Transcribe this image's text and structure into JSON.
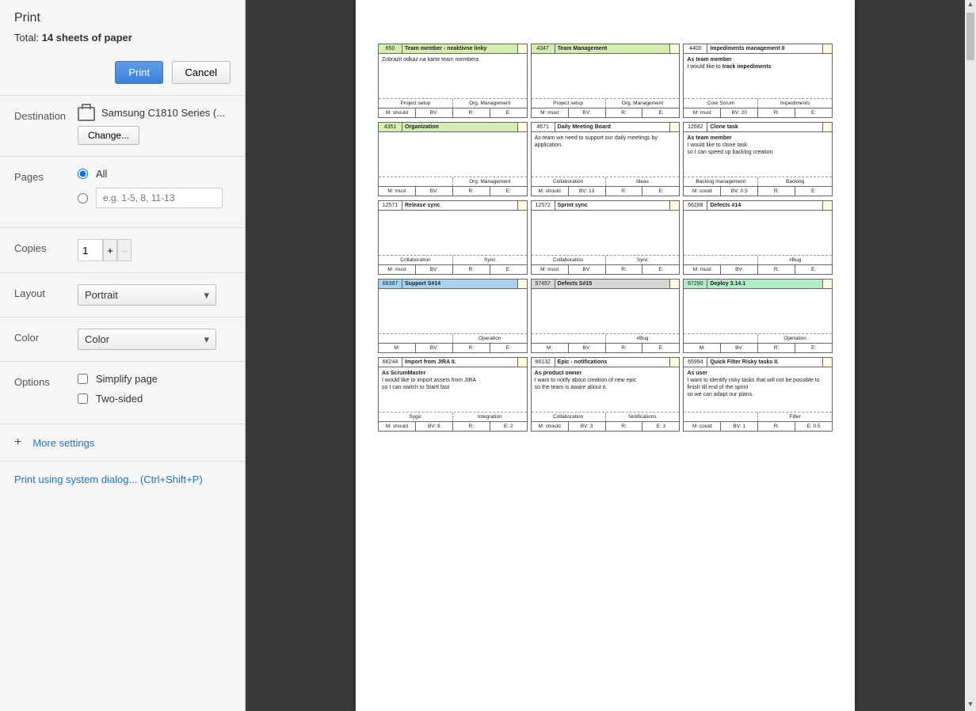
{
  "sidebar": {
    "title": "Print",
    "total_prefix": "Total: ",
    "total_value": "14 sheets of paper",
    "print_btn": "Print",
    "cancel_btn": "Cancel",
    "destination_label": "Destination",
    "destination_value": "Samsung C1810 Series (...",
    "change_btn": "Change...",
    "pages_label": "Pages",
    "pages_all": "All",
    "pages_placeholder": "e.g. 1-5, 8, 11-13",
    "copies_label": "Copies",
    "copies_value": "1",
    "layout_label": "Layout",
    "layout_value": "Portrait",
    "color_label": "Color",
    "color_value": "Color",
    "options_label": "Options",
    "opt_simplify": "Simplify page",
    "opt_twosided": "Two-sided",
    "more_settings": "More settings",
    "system_dialog": "Print using system dialog... (Ctrl+Shift+P)"
  },
  "cards": [
    [
      {
        "id": "650",
        "title": "Team member - neaktivne linky",
        "head_bg": "bg-green",
        "body": "Zobrazit odkaz na karte team membera",
        "tags": [
          "Project setup",
          "Org. Management"
        ],
        "meta": [
          "M: should",
          "BV:",
          "R:",
          "E:"
        ]
      },
      {
        "id": "4347",
        "title": "Team Management",
        "head_bg": "bg-green",
        "body": "",
        "tags": [
          "Project setup",
          "Org. Management"
        ],
        "meta": [
          "M: must",
          "BV:",
          "R:",
          "E:"
        ]
      },
      {
        "id": "4400",
        "title": "Impediments management II",
        "head_bg": "",
        "body": "<b>As team member</b><br>I would like to <b>track impediments</b>",
        "tags": [
          "Core Scrum",
          "Impediments"
        ],
        "meta": [
          "M: must",
          "BV: 20",
          "R:",
          "E:"
        ]
      }
    ],
    [
      {
        "id": "4351",
        "title": "Organization",
        "head_bg": "bg-green",
        "body": "",
        "tags": [
          "",
          "Org. Management"
        ],
        "meta": [
          "M: must",
          "BV:",
          "R:",
          "E:"
        ]
      },
      {
        "id": "4671",
        "title": "Daily Meeting Board",
        "head_bg": "",
        "body": "As team we need to support our daily meetings by application.",
        "tags": [
          "Collaboration",
          "Ideas"
        ],
        "meta": [
          "M: should",
          "BV: 13",
          "R:",
          "E:"
        ]
      },
      {
        "id": "12682",
        "title": "Clone task",
        "head_bg": "",
        "body": "<b>As team member</b><br>I would like to clone task<br>so I can speed up backlog creation",
        "tags": [
          "Backlog management",
          "Backlog"
        ],
        "meta": [
          "M: could",
          "BV: 0.5",
          "R:",
          "E:"
        ]
      }
    ],
    [
      {
        "id": "12571",
        "title": "Release sync",
        "head_bg": "",
        "body": "",
        "tags": [
          "Collaboration",
          "Sync"
        ],
        "meta": [
          "M: must",
          "BV:",
          "R:",
          "E:"
        ]
      },
      {
        "id": "12572",
        "title": "Sprint sync",
        "head_bg": "",
        "body": "",
        "tags": [
          "Collaboration",
          "Sync"
        ],
        "meta": [
          "M: must",
          "BV:",
          "R:",
          "E:"
        ]
      },
      {
        "id": "66288",
        "title": "Defects #14",
        "head_bg": "",
        "body": "",
        "tags": [
          "",
          "#Bug"
        ],
        "meta": [
          "M: must",
          "BV:",
          "R:",
          "E:"
        ]
      }
    ],
    [
      {
        "id": "68387",
        "title": "Support S#14",
        "head_bg": "bg-blue",
        "body": "",
        "tags": [
          "",
          "Operation"
        ],
        "meta": [
          "M:",
          "BV:",
          "R:",
          "E:"
        ]
      },
      {
        "id": "57457",
        "title": "Defects S#15",
        "head_bg": "bg-grey",
        "body": "",
        "tags": [
          "",
          "#Bug"
        ],
        "meta": [
          "M:",
          "BV:",
          "R:",
          "E:"
        ]
      },
      {
        "id": "67290",
        "title": "Deploy 3.14.1",
        "head_bg": "bg-mint",
        "body": "",
        "tags": [
          "",
          "Operation"
        ],
        "meta": [
          "M:",
          "BV:",
          "R:",
          "E:"
        ]
      }
    ],
    [
      {
        "id": "66244",
        "title": "Import from JIRA II.",
        "head_bg": "",
        "body": "<b>As ScrumMaster</b><br>I would like to import assets from JIRA<br>so I can switch to Startl fast",
        "tags": [
          "Sygic",
          "Integration"
        ],
        "meta": [
          "M: should",
          "BV: 8",
          "R:",
          "E: 2"
        ]
      },
      {
        "id": "66132",
        "title": "Epic - notifications",
        "head_bg": "",
        "body": "<b>As product owner</b><br>I want to notify about creation of new epic<br>so the team is aware about it.",
        "tags": [
          "Collaboration",
          "Notifications"
        ],
        "meta": [
          "M: should",
          "BV: 3",
          "R:",
          "E: 3"
        ]
      },
      {
        "id": "65994",
        "title": "Quick Filter Risky tasks II.",
        "head_bg": "",
        "body": "<b>As user</b><br>I want to identify risky tasks that will not be possible to finish till end of the sprint<br>so we can adapt our plans.",
        "tags": [
          "",
          "Filter"
        ],
        "meta": [
          "M: could",
          "BV: 1",
          "R:",
          "E: 0.5"
        ]
      }
    ]
  ]
}
